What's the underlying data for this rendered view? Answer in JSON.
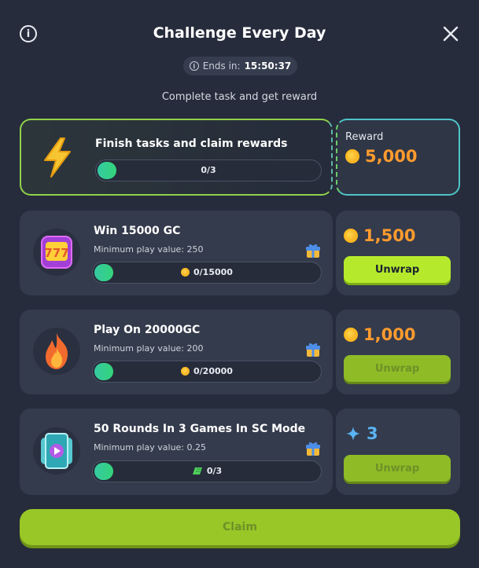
{
  "header": {
    "title": "Challenge Every Day",
    "info_icon": "info-icon",
    "close_icon": "close-icon"
  },
  "timer": {
    "label": "Ends in:",
    "value": "15:50:37"
  },
  "subtitle": "Complete task and get reward",
  "summary": {
    "title": "Finish tasks and claim rewards",
    "progress_text": "0/3",
    "progress": 0,
    "reward_label": "Reward",
    "reward_value": "5,000",
    "icon": "lightning-icon"
  },
  "tasks": [
    {
      "title": "Win 15000 GC",
      "min_play": "Minimum play value: 250",
      "progress_text": "0/15000",
      "progress": 0,
      "progress_icon": "coin-icon",
      "reward_value": "1,500",
      "reward_icon": "coin-icon",
      "button_label": "Unwrap",
      "button_state": "active",
      "icon": "slot-777-icon"
    },
    {
      "title": "Play On 20000GC",
      "min_play": "Minimum play value: 200",
      "progress_text": "0/20000",
      "progress": 0,
      "progress_icon": "coin-icon",
      "reward_value": "1,000",
      "reward_icon": "coin-icon",
      "button_label": "Unwrap",
      "button_state": "disabled",
      "icon": "fire-icon"
    },
    {
      "title": "50 Rounds In 3 Games In SC Mode",
      "min_play": "Minimum play value: 0.25",
      "progress_text": "0/3",
      "progress": 0,
      "progress_icon": "ticket-icon",
      "reward_value": "3",
      "reward_icon": "star-icon",
      "button_label": "Unwrap",
      "button_state": "disabled",
      "icon": "video-card-icon"
    }
  ],
  "claim_button": {
    "label": "Claim",
    "state": "disabled"
  },
  "colors": {
    "background": "#262c3b",
    "card": "#343b4c",
    "accent_green": "#b5ea2c",
    "reward_orange": "#ff9b2e",
    "reward_blue": "#5ab4f3",
    "progress_fill": "#36c9a3"
  }
}
